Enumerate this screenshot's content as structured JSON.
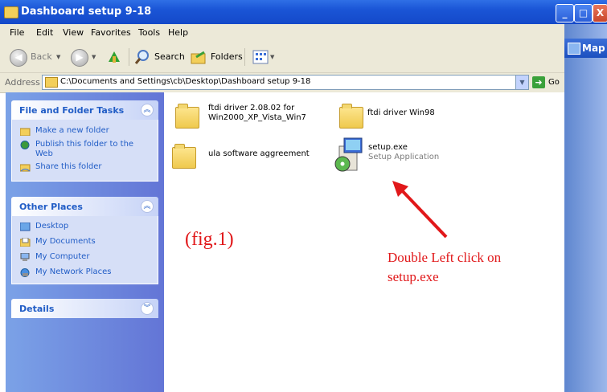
{
  "window": {
    "title": "Dashboard setup 9-18",
    "controls": {
      "minimize": "_",
      "maximize": "□",
      "close": "X"
    }
  },
  "menu": [
    "File",
    "Edit",
    "View",
    "Favorites",
    "Tools",
    "Help"
  ],
  "toolbar": {
    "back": "Back",
    "search": "Search",
    "folders": "Folders"
  },
  "address": {
    "label": "Address",
    "path": "C:\\Documents and Settings\\cb\\Desktop\\Dashboard setup 9-18",
    "go": "Go"
  },
  "tasks": {
    "file_folder": {
      "title": "File and Folder Tasks",
      "items": [
        "Make a new folder",
        "Publish this folder to the Web",
        "Share this folder"
      ]
    },
    "other_places": {
      "title": "Other Places",
      "items": [
        "Desktop",
        "My Documents",
        "My Computer",
        "My Network Places"
      ]
    },
    "details": {
      "title": "Details"
    }
  },
  "files": [
    {
      "name_line1": "ftdi driver 2.08.02 for",
      "name_line2": "Win2000_XP_Vista_Win7",
      "type": "folder"
    },
    {
      "name": "ftdi driver Win98",
      "type": "folder"
    },
    {
      "name": "ula software aggreement",
      "type": "folder"
    },
    {
      "name": "setup.exe",
      "subtitle": "Setup Application",
      "type": "application"
    }
  ],
  "annotations": {
    "figure": "(fig.1)",
    "instruction_line1": "Double Left click on",
    "instruction_line2": "setup.exe"
  },
  "background_window": {
    "title": "Map"
  },
  "colors": {
    "titlebar": "#1a55d6",
    "task_pane": "#6f8ee0",
    "link": "#215dc6",
    "annotation": "#e1181a"
  }
}
